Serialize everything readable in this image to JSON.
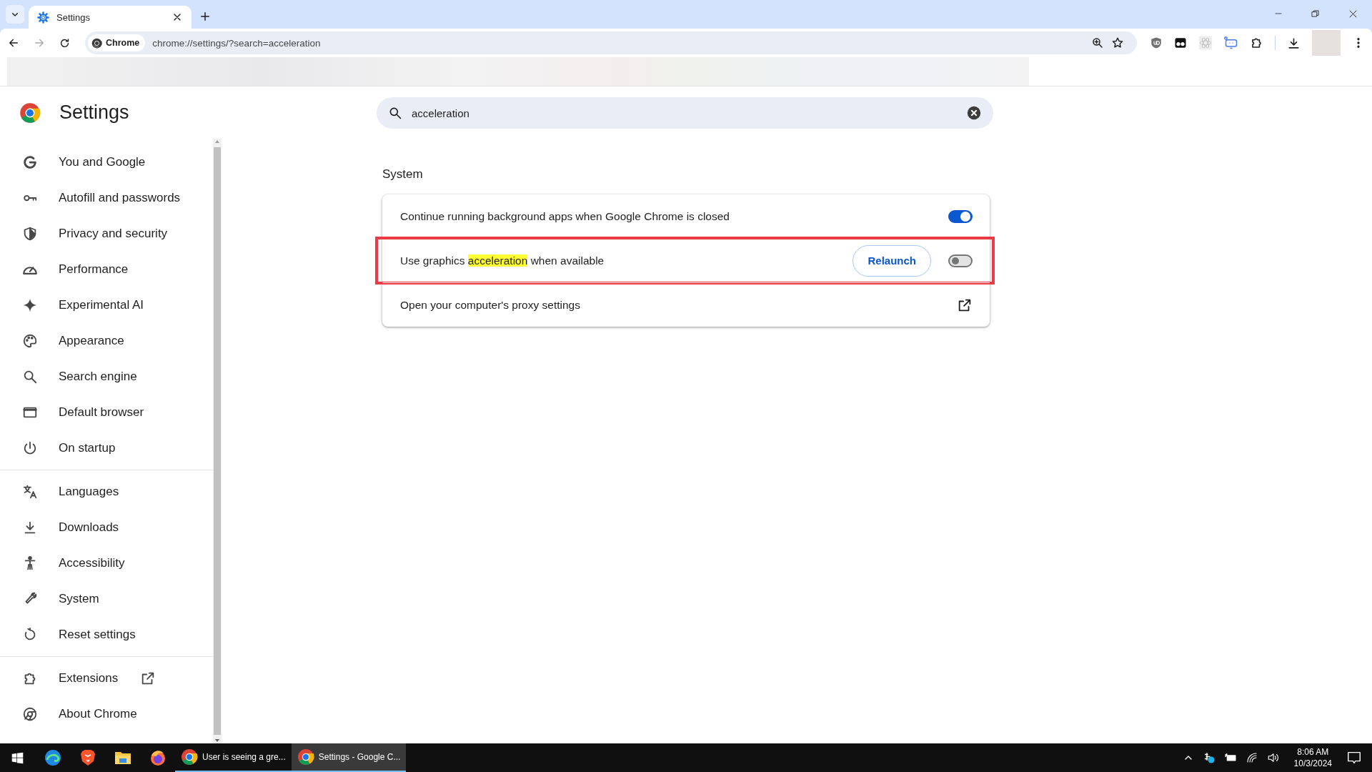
{
  "window": {
    "tabs": [
      {
        "title": "Settings",
        "selected": true
      }
    ],
    "address": {
      "chip": "Chrome",
      "url": "chrome://settings/?search=acceleration"
    }
  },
  "settings": {
    "title": "Settings",
    "search": {
      "value": "acceleration"
    },
    "nav_groups": [
      {
        "items": [
          {
            "label": "You and Google",
            "selected": false
          },
          {
            "label": "Autofill and passwords",
            "selected": false
          },
          {
            "label": "Privacy and security",
            "selected": false
          },
          {
            "label": "Performance",
            "selected": false
          },
          {
            "label": "Experimental AI",
            "selected": false
          },
          {
            "label": "Appearance",
            "selected": false
          },
          {
            "label": "Search engine",
            "selected": false
          },
          {
            "label": "Default browser",
            "selected": false
          },
          {
            "label": "On startup",
            "selected": false
          }
        ]
      },
      {
        "items": [
          {
            "label": "Languages",
            "selected": false
          },
          {
            "label": "Downloads",
            "selected": false
          },
          {
            "label": "Accessibility",
            "selected": false
          },
          {
            "label": "System",
            "selected": false
          },
          {
            "label": "Reset settings",
            "selected": false
          }
        ]
      },
      {
        "items": [
          {
            "label": "Extensions",
            "selected": false,
            "external": true
          },
          {
            "label": "About Chrome",
            "selected": false,
            "external": false
          }
        ]
      }
    ],
    "section_title": "System",
    "rows": [
      {
        "kind": "toggle",
        "parts": [
          {
            "text": "Continue running background apps when Google Chrome is closed",
            "match": false
          }
        ],
        "on": true,
        "framed": false
      },
      {
        "kind": "toggle",
        "parts": [
          {
            "text": "Use graphics",
            "match": false
          },
          {
            "text": "acceleration",
            "match": true
          },
          {
            "text": "when available",
            "match": false
          }
        ],
        "button": "Relaunch",
        "on": false,
        "framed": true
      },
      {
        "kind": "link",
        "parts": [
          {
            "text": "Open your computer's proxy settings",
            "match": false
          }
        ],
        "framed": false
      }
    ]
  },
  "taskbar": {
    "windows": [
      {
        "title": "User is seeing a gre...",
        "selected": false
      },
      {
        "title": "Settings - Google C...",
        "selected": true
      }
    ],
    "clock": {
      "time": "8:06 AM",
      "date": "10/3/2024"
    }
  }
}
